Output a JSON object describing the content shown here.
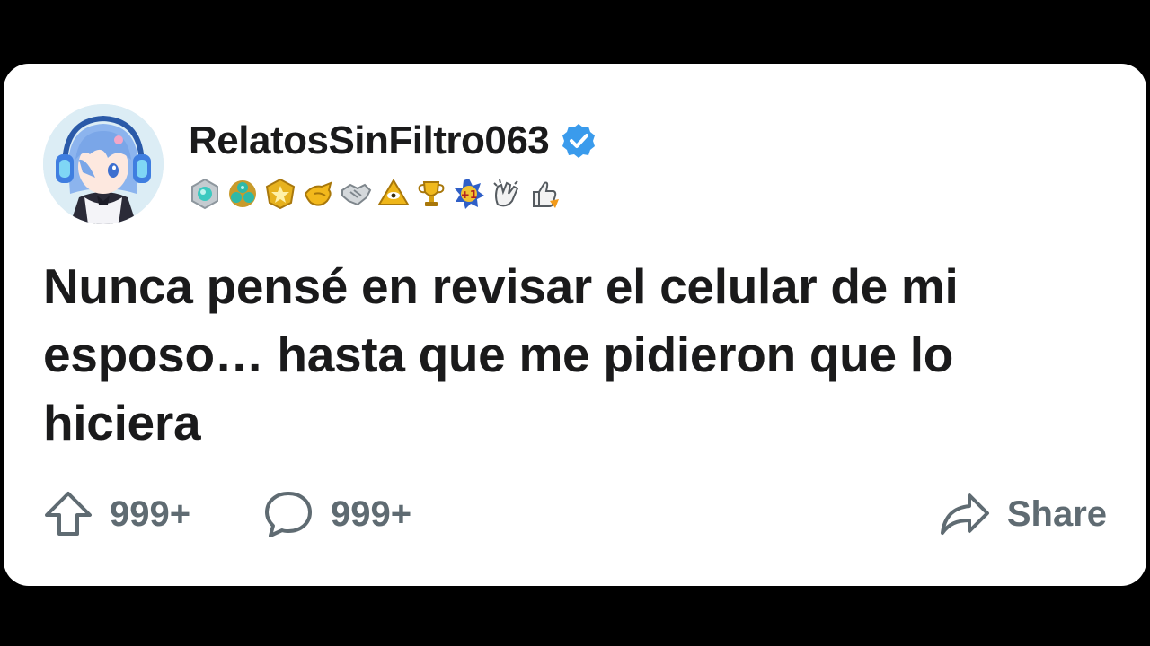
{
  "post": {
    "author": {
      "username": "RelatosSinFiltro063",
      "verified": true,
      "avatar_icon": "anime-girl-headphones-avatar"
    },
    "badges": [
      "teal-gem-badge-icon",
      "triple-gem-badge-icon",
      "gold-star-shield-icon",
      "gold-pointing-hand-icon",
      "silver-handshake-icon",
      "gold-pyramid-eye-icon",
      "gold-trophy-icon",
      "plus-one-starburst-icon",
      "clapping-hands-icon",
      "thumbs-up-rocket-icon"
    ],
    "title": "Nunca pensé en revisar el celular de mi esposo… hasta que me pidieron que lo hiciera",
    "actions": {
      "upvotes": "999+",
      "comments": "999+",
      "share_label": "Share"
    }
  },
  "colors": {
    "background": "#000000",
    "card": "#ffffff",
    "text": "#1a1a1b",
    "muted": "#5f6b72",
    "verified": "#3a9bec"
  }
}
